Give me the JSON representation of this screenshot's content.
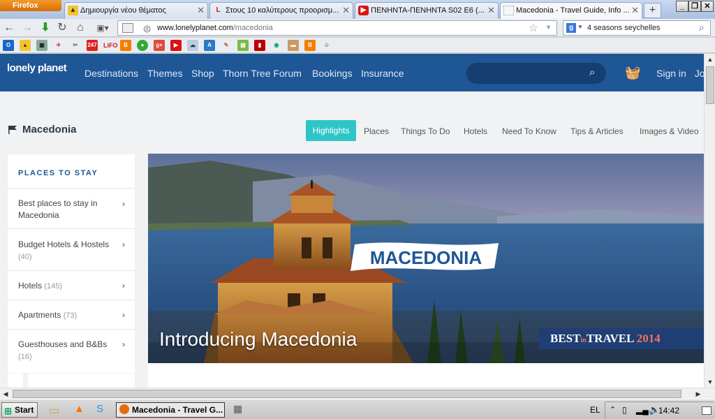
{
  "browser": {
    "app_button": "Firefox",
    "tabs": [
      {
        "title": "Δημιουργία νέου θέματος",
        "active": false
      },
      {
        "title": "Στους 10 καλύτερους προορισμ...",
        "active": false
      },
      {
        "title": "ΠΕΝΗΝΤΑ-ΠΕΝΗΝΤΑ S02 E6 (...",
        "active": false
      },
      {
        "title": "Macedonia - Travel Guide, Info ...",
        "active": true
      }
    ],
    "new_tab": "+",
    "url_domain": "www.lonelyplanet.com",
    "url_path": "/macedonia",
    "search_value": "4 seasons seychelles"
  },
  "site": {
    "logo": "lonely planet",
    "nav": [
      "Destinations",
      "Themes",
      "Shop",
      "Thorn Tree Forum",
      "Bookings",
      "Insurance"
    ],
    "signin": "Sign in",
    "join": "Join"
  },
  "location": {
    "name": "Macedonia",
    "tabs": [
      "Highlights",
      "Places",
      "Things To Do",
      "Hotels",
      "Need To Know",
      "Tips & Articles",
      "Images & Video"
    ]
  },
  "sidebar": {
    "heading": "PLACES TO STAY",
    "items": [
      {
        "label": "Best places to stay in Macedonia",
        "count": ""
      },
      {
        "label": "Budget Hotels & Hostels",
        "count": "(40)"
      },
      {
        "label": "Hotels",
        "count": "(145)"
      },
      {
        "label": "Apartments",
        "count": "(73)"
      },
      {
        "label": "Guesthouses and B&Bs",
        "count": "(16)"
      }
    ]
  },
  "hero": {
    "title": "Introducing Macedonia",
    "banner": "MACEDONIA",
    "badge_best": "BEST",
    "badge_in": "in",
    "badge_travel": "TRAVEL",
    "badge_year": "2014"
  },
  "taskbar": {
    "start": "Start",
    "task": "Macedonia - Travel G...",
    "lang": "EL",
    "clock": "14:42"
  }
}
